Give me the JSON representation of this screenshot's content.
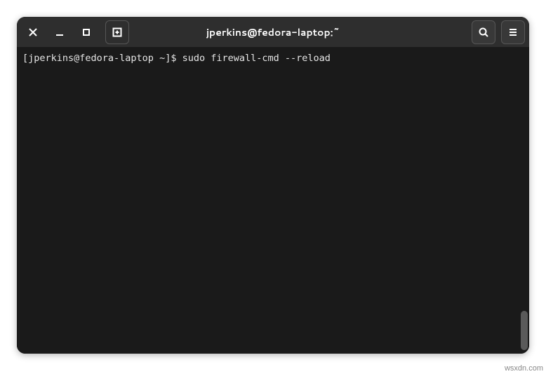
{
  "window": {
    "title": "jperkins@fedora-laptop:~"
  },
  "terminal": {
    "prompt": "[jperkins@fedora-laptop ~]$ ",
    "command": "sudo firewall-cmd --reload"
  },
  "icons": {
    "close": "close",
    "minimize": "minimize",
    "maximize": "maximize",
    "newtab": "newtab",
    "search": "search",
    "menu": "menu"
  },
  "watermark": "wsxdn.com"
}
